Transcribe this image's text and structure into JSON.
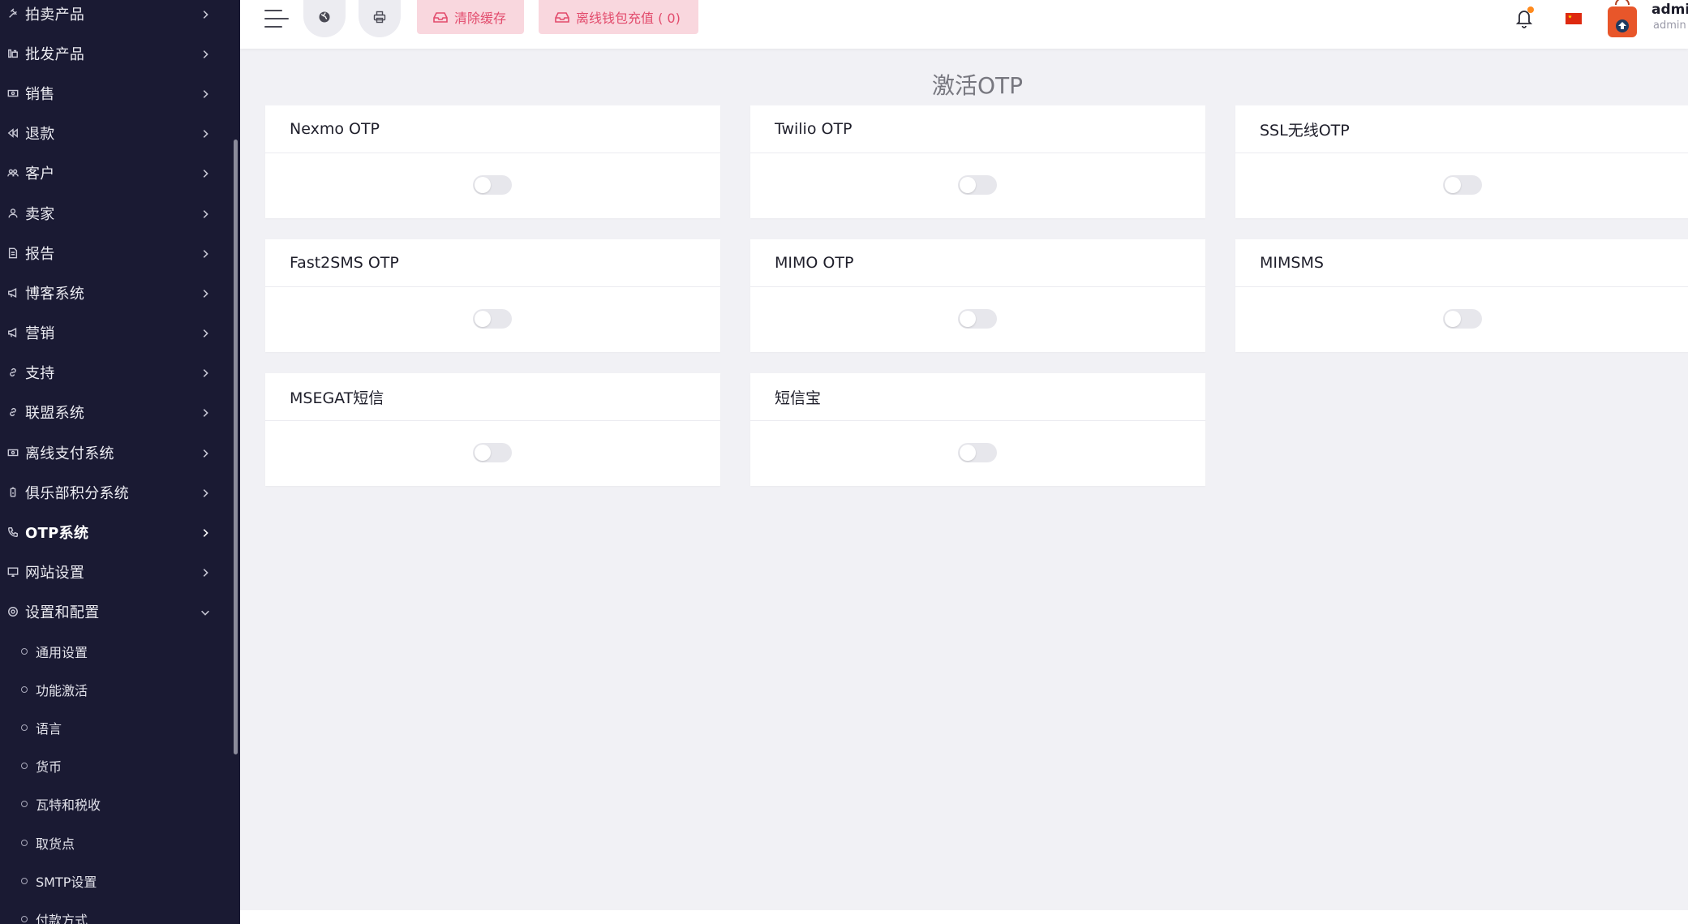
{
  "sidebar": {
    "items": [
      {
        "label": "拍卖产品",
        "icon": "gavel-icon"
      },
      {
        "label": "批发产品",
        "icon": "wholesale-icon"
      },
      {
        "label": "销售",
        "icon": "money-icon"
      },
      {
        "label": "退款",
        "icon": "backward-icon"
      },
      {
        "label": "客户",
        "icon": "users-icon"
      },
      {
        "label": "卖家",
        "icon": "user-icon"
      },
      {
        "label": "报告",
        "icon": "file-icon"
      },
      {
        "label": "博客系统",
        "icon": "bullhorn-icon"
      },
      {
        "label": "营销",
        "icon": "bullhorn-icon"
      },
      {
        "label": "支持",
        "icon": "link-icon"
      },
      {
        "label": "联盟系统",
        "icon": "link-icon"
      },
      {
        "label": "离线支付系统",
        "icon": "money-icon"
      },
      {
        "label": "俱乐部积分系统",
        "icon": "battery-icon"
      },
      {
        "label": "OTP系统",
        "icon": "phone-icon",
        "active": true
      },
      {
        "label": "网站设置",
        "icon": "monitor-icon"
      },
      {
        "label": "设置和配置",
        "icon": "settings-icon",
        "expanded": true
      }
    ],
    "subitems": [
      {
        "label": "通用设置"
      },
      {
        "label": "功能激活"
      },
      {
        "label": "语言"
      },
      {
        "label": "货币"
      },
      {
        "label": "瓦特和税收"
      },
      {
        "label": "取货点"
      },
      {
        "label": "SMTP设置"
      },
      {
        "label": "付款方式"
      }
    ]
  },
  "header": {
    "menu_icon": "menu-icon",
    "globe_icon": "globe-icon",
    "print_icon": "printer-icon",
    "clear_cache_label": "清除缓存",
    "offline_wallet_label": "离线钱包充值 ( 0)",
    "notification_icon": "bell-icon",
    "language_flag": "china-flag-icon",
    "user": {
      "name": "admin",
      "role": "admin"
    }
  },
  "main": {
    "title": "激活OTP",
    "cards": [
      {
        "title": "Nexmo OTP",
        "enabled": false
      },
      {
        "title": "Twilio OTP",
        "enabled": false
      },
      {
        "title": "SSL无线OTP",
        "enabled": false
      },
      {
        "title": "Fast2SMS OTP",
        "enabled": false
      },
      {
        "title": "MIMO OTP",
        "enabled": false
      },
      {
        "title": "MIMSMS",
        "enabled": false
      },
      {
        "title": "MSEGAT短信",
        "enabled": false
      },
      {
        "title": "短信宝",
        "enabled": false
      }
    ]
  },
  "colors": {
    "sidebar_bg": "#1a1a33",
    "page_bg": "#f1f1f5",
    "accent_pink": "#e24b6c",
    "pink_button_bg": "#f9d7de",
    "notification_dot": "#ff8a1d"
  }
}
